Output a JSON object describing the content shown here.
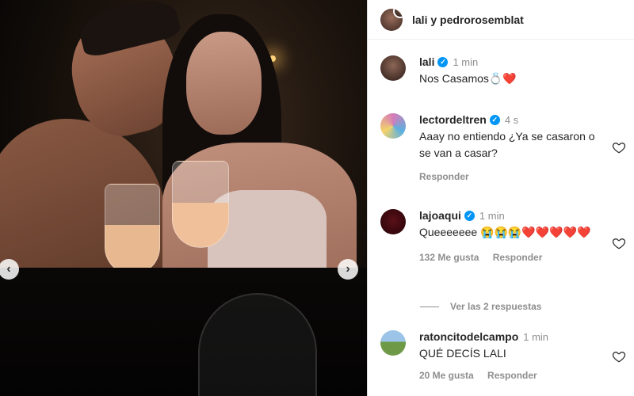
{
  "header": {
    "names": "lali y pedrorosemblat"
  },
  "comments": [
    {
      "user": "lali",
      "verified": true,
      "time": "1 min",
      "text": "Nos Casamos💍❤️",
      "likes": "",
      "reply_label": ""
    },
    {
      "user": "lectordeltren",
      "verified": true,
      "time": "4 s",
      "text": "Aaay no entiendo ¿Ya se casaron o se van a casar?",
      "likes": "",
      "reply_label": "Responder"
    },
    {
      "user": "lajoaqui",
      "verified": true,
      "time": "1 min",
      "text": "Queeeeeee 😭😭😭❤️❤️❤️❤️❤️",
      "likes": "132 Me gusta",
      "reply_label": "Responder"
    },
    {
      "user": "ratoncitodelcampo",
      "verified": false,
      "time": "1 min",
      "text": "QUÉ DECÍS LALI",
      "likes": "20 Me gusta",
      "reply_label": "Responder"
    }
  ],
  "view_replies": "Ver las 2 respuestas",
  "nav": {
    "prev": "‹",
    "next": "›"
  },
  "colors": {
    "accent": "#0095f6",
    "heart_red": "#ed1c24",
    "muted": "#8e8e8e"
  },
  "icons": {
    "verified": "verified-badge-icon",
    "heart": "heart-outline-icon"
  }
}
